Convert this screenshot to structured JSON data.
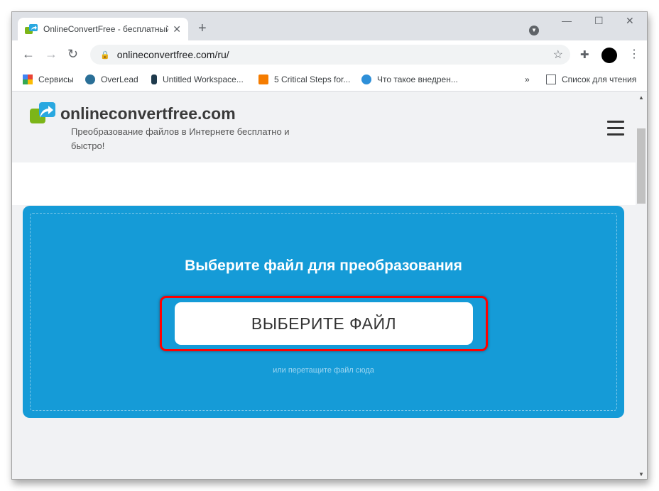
{
  "browser": {
    "tab_title": "OnlineConvertFree - бесплатный",
    "url": "onlineconvertfree.com/ru/",
    "bookmarks": [
      {
        "label": "Сервисы",
        "icon": "apps-grid-icon"
      },
      {
        "label": "OverLead",
        "icon": "overlead-icon"
      },
      {
        "label": "Untitled Workspace...",
        "icon": "workspace-icon"
      },
      {
        "label": "5 Critical Steps for...",
        "icon": "chat-bubble-icon"
      },
      {
        "label": "Что такое внедрен...",
        "icon": "w-circle-icon"
      }
    ],
    "reading_list": "Список для чтения",
    "more_bookmarks": "»"
  },
  "site": {
    "brand": "onlineconvertfree.com",
    "tagline": "Преобразование файлов в Интернете бесплатно и быстро!",
    "drop_title": "Выберите файл для преобразования",
    "choose_button": "ВЫБЕРИТЕ ФАЙЛ",
    "drop_hint": "или перетащите файл сюда"
  },
  "colors": {
    "accent": "#159bd7",
    "highlight": "#ff0000"
  }
}
